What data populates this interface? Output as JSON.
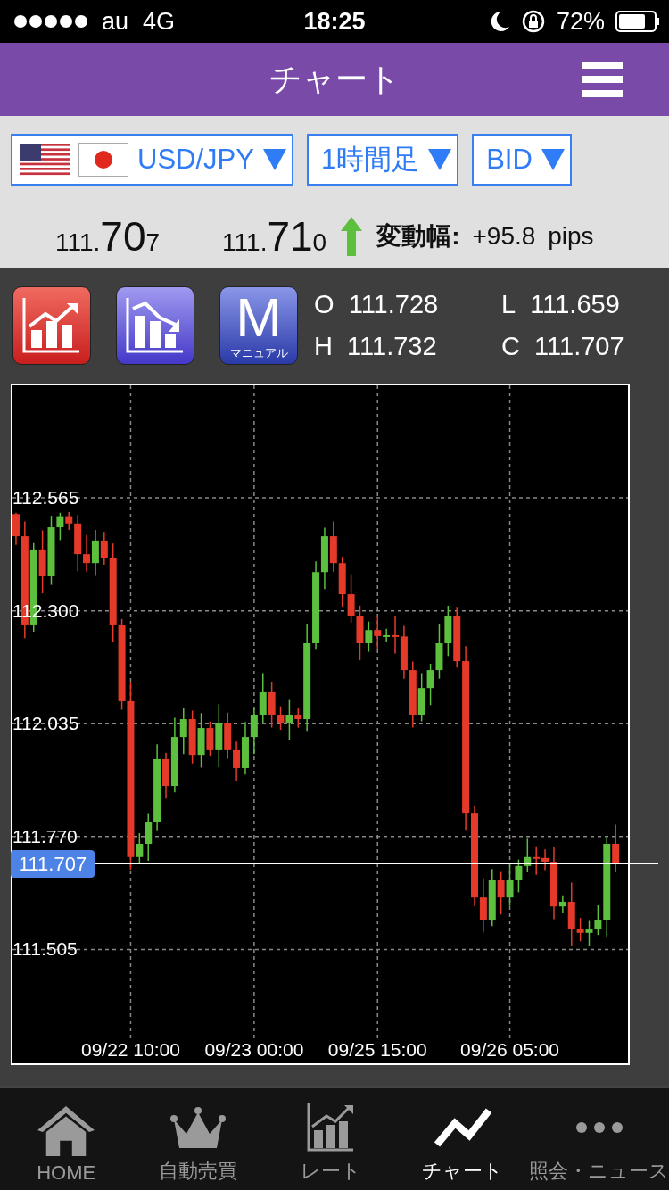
{
  "status_bar": {
    "carrier": "au",
    "network": "4G",
    "time": "18:25",
    "battery": "72%"
  },
  "header": {
    "title": "チャート"
  },
  "selectors": [
    {
      "kind": "pair",
      "label": "USD/JPY"
    },
    {
      "kind": "plain",
      "label": "1時間足"
    },
    {
      "kind": "plain",
      "label": "BID"
    }
  ],
  "quotes": [
    {
      "prefix": "111.",
      "major": "70",
      "minor": "7"
    },
    {
      "prefix": "111.",
      "major": "71",
      "minor": "0"
    }
  ],
  "change": {
    "up": true,
    "label": "変動幅:",
    "value": "+95.8 pips"
  },
  "tools": [
    {
      "kind": "up"
    },
    {
      "kind": "down"
    },
    {
      "kind": "manual",
      "letter": "M",
      "caption": "マニュアル"
    }
  ],
  "ohlc": [
    {
      "label": "O",
      "value": "111.728"
    },
    {
      "label": "L",
      "value": "111.659"
    },
    {
      "label": "H",
      "value": "111.732"
    },
    {
      "label": "C",
      "value": "111.707"
    }
  ],
  "chart": {
    "chart_data": {
      "type": "candlestick",
      "grid": true,
      "ylim": [
        111.238,
        112.829
      ],
      "ref_lines": [
        {
          "axis": "y",
          "value": 111.707,
          "label": "111.707"
        }
      ],
      "categories": [
        null,
        null,
        null,
        null,
        null,
        null,
        null,
        null,
        null,
        null,
        null,
        null,
        null,
        "09/22 10:00",
        null,
        null,
        null,
        null,
        null,
        null,
        null,
        null,
        null,
        null,
        null,
        null,
        null,
        "09/23 00:00",
        null,
        null,
        null,
        null,
        null,
        null,
        null,
        null,
        null,
        null,
        null,
        null,
        null,
        "09/25 15:00",
        null,
        null,
        null,
        null,
        null,
        null,
        null,
        null,
        null,
        null,
        null,
        null,
        null,
        null,
        "09/26 05:00",
        null,
        null,
        null,
        null,
        null,
        null,
        null,
        null,
        null,
        null,
        null,
        null
      ],
      "yticks": [
        {
          "value": 112.565,
          "label": "112.565"
        },
        {
          "value": 112.3,
          "label": "112.300"
        },
        {
          "value": 112.035,
          "label": "112.035"
        },
        {
          "value": 111.77,
          "label": "111.770"
        },
        {
          "value": 111.505,
          "label": "111.505"
        }
      ],
      "ohlc": [
        [
          112.527,
          112.53,
          112.455,
          112.475
        ],
        [
          112.475,
          112.51,
          112.236,
          112.266
        ],
        [
          112.266,
          112.459,
          112.251,
          112.444
        ],
        [
          112.444,
          112.489,
          112.341,
          112.381
        ],
        [
          112.381,
          112.521,
          112.361,
          112.496
        ],
        [
          112.496,
          112.53,
          112.466,
          112.52
        ],
        [
          112.52,
          112.532,
          112.49,
          112.505
        ],
        [
          112.505,
          112.525,
          112.393,
          112.433
        ],
        [
          112.433,
          112.478,
          112.392,
          112.412
        ],
        [
          112.412,
          112.49,
          112.382,
          112.465
        ],
        [
          112.465,
          112.485,
          112.408,
          112.423
        ],
        [
          112.423,
          112.458,
          112.226,
          112.266
        ],
        [
          112.266,
          112.281,
          112.068,
          112.088
        ],
        [
          112.088,
          112.133,
          111.692,
          111.722
        ],
        [
          111.722,
          111.778,
          111.707,
          111.753
        ],
        [
          111.753,
          111.825,
          111.713,
          111.805
        ],
        [
          111.805,
          111.987,
          111.785,
          111.952
        ],
        [
          111.952,
          111.967,
          111.859,
          111.889
        ],
        [
          111.889,
          112.049,
          111.874,
          112.004
        ],
        [
          112.004,
          112.071,
          111.964,
          112.046
        ],
        [
          112.046,
          112.066,
          111.942,
          111.962
        ],
        [
          111.962,
          112.06,
          111.932,
          112.025
        ],
        [
          112.025,
          112.04,
          111.958,
          111.973
        ],
        [
          111.973,
          112.081,
          111.933,
          112.036
        ],
        [
          112.036,
          112.061,
          111.953,
          111.973
        ],
        [
          111.973,
          111.993,
          111.901,
          111.931
        ],
        [
          111.931,
          112.039,
          111.916,
          112.004
        ],
        [
          112.004,
          112.071,
          111.964,
          112.056
        ],
        [
          112.056,
          112.154,
          112.036,
          112.109
        ],
        [
          112.109,
          112.134,
          112.026,
          112.056
        ],
        [
          112.056,
          112.076,
          112.021,
          112.036
        ],
        [
          112.036,
          112.091,
          111.996,
          112.056
        ],
        [
          112.056,
          112.071,
          112.026,
          112.046
        ],
        [
          112.046,
          112.269,
          112.016,
          112.224
        ],
        [
          112.224,
          112.416,
          112.209,
          112.391
        ],
        [
          112.391,
          112.495,
          112.351,
          112.475
        ],
        [
          112.475,
          112.51,
          112.392,
          112.412
        ],
        [
          112.412,
          112.427,
          112.309,
          112.339
        ],
        [
          112.339,
          112.384,
          112.272,
          112.287
        ],
        [
          112.287,
          112.312,
          112.184,
          112.224
        ],
        [
          112.224,
          112.275,
          112.204,
          112.255
        ],
        [
          112.255,
          112.29,
          112.211,
          112.241
        ],
        [
          112.241,
          112.258,
          112.226,
          112.243
        ],
        [
          112.243,
          112.288,
          112.2,
          112.24
        ],
        [
          112.24,
          112.265,
          112.141,
          112.161
        ],
        [
          112.161,
          112.181,
          112.026,
          112.056
        ],
        [
          112.056,
          112.154,
          112.041,
          112.119
        ],
        [
          112.119,
          112.176,
          112.079,
          112.161
        ],
        [
          112.161,
          112.269,
          112.141,
          112.224
        ],
        [
          112.224,
          112.312,
          112.194,
          112.287
        ],
        [
          112.287,
          112.307,
          112.167,
          112.182
        ],
        [
          112.182,
          112.217,
          111.786,
          111.826
        ],
        [
          111.826,
          111.841,
          111.607,
          111.627
        ],
        [
          111.627,
          111.672,
          111.545,
          111.575
        ],
        [
          111.575,
          111.694,
          111.56,
          111.669
        ],
        [
          111.669,
          111.689,
          111.587,
          111.627
        ],
        [
          111.627,
          111.704,
          111.607,
          111.669
        ],
        [
          111.669,
          111.716,
          111.639,
          111.701
        ],
        [
          111.701,
          111.767,
          111.686,
          111.722
        ],
        [
          111.722,
          111.747,
          111.68,
          111.72
        ],
        [
          111.72,
          111.74,
          111.691,
          111.711
        ],
        [
          111.711,
          111.746,
          111.576,
          111.606
        ],
        [
          111.606,
          111.632,
          111.591,
          111.617
        ],
        [
          111.617,
          111.662,
          111.514,
          111.554
        ],
        [
          111.554,
          111.579,
          111.524,
          111.544
        ],
        [
          111.544,
          111.574,
          111.514,
          111.554
        ],
        [
          111.554,
          111.61,
          111.539,
          111.575
        ],
        [
          111.575,
          111.768,
          111.535,
          111.753
        ],
        [
          111.753,
          111.798,
          111.687,
          111.707
        ]
      ]
    }
  },
  "tabs": [
    {
      "kind": "home",
      "label": "HOME",
      "selected": false
    },
    {
      "kind": "crown",
      "label": "自動売買",
      "selected": false
    },
    {
      "kind": "rate",
      "label": "レート",
      "selected": false
    },
    {
      "kind": "chart",
      "label": "チャート",
      "selected": true
    },
    {
      "kind": "more",
      "label": "照会・ニュース",
      "selected": false
    }
  ]
}
